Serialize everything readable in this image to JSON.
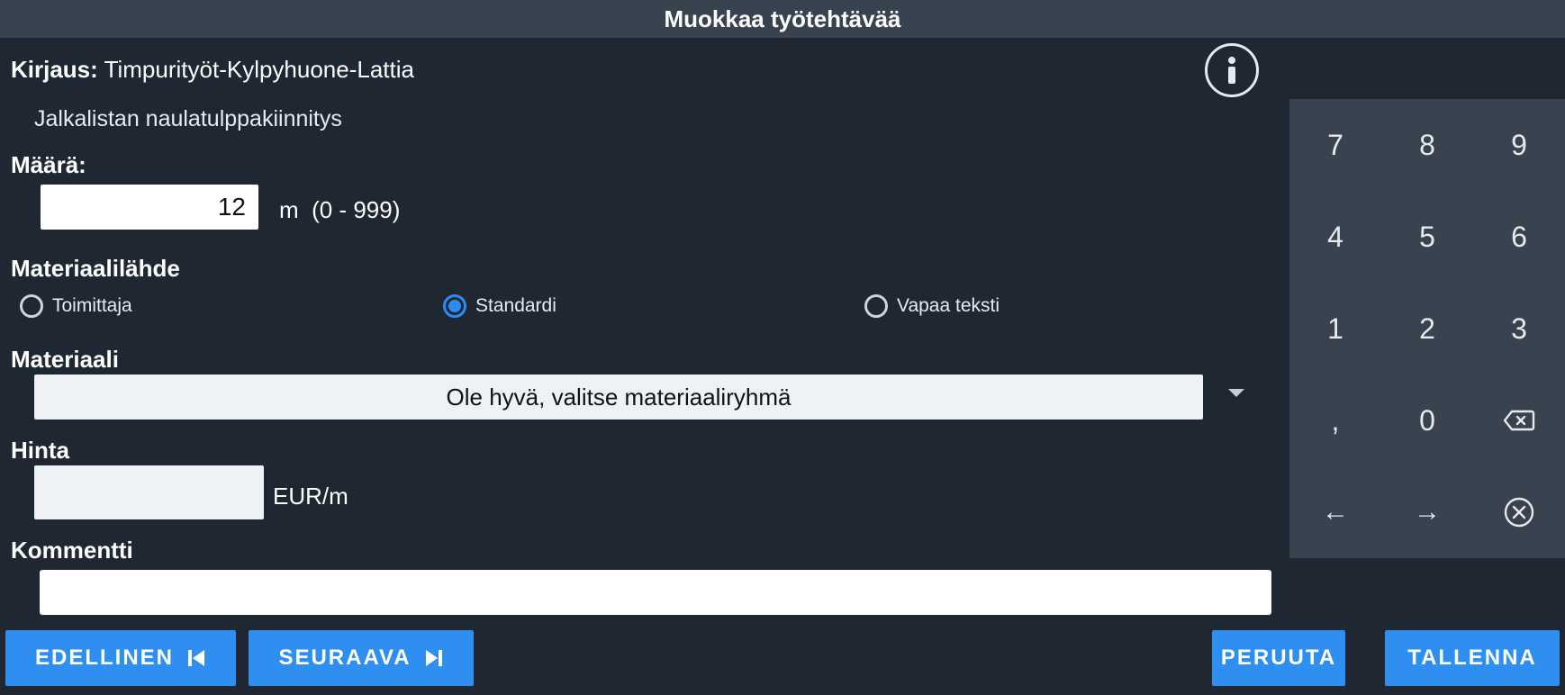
{
  "dialog": {
    "title": "Muokkaa työtehtävää"
  },
  "entry": {
    "label": "Kirjaus:",
    "value": "Timpurityöt-Kylpyhuone-Lattia",
    "description": "Jalkalistan naulatulppakiinnitys"
  },
  "quantity": {
    "label": "Määrä:",
    "value": "12",
    "unit_range": "m  (0 - 999)"
  },
  "material_source": {
    "label": "Materiaalilähde",
    "options": [
      {
        "label": "Toimittaja",
        "selected": false
      },
      {
        "label": "Standardi",
        "selected": true
      },
      {
        "label": "Vapaa teksti",
        "selected": false
      }
    ]
  },
  "material": {
    "label": "Materiaali",
    "placeholder": "Ole hyvä, valitse materiaaliryhmä"
  },
  "price": {
    "label": "Hinta",
    "value": "",
    "unit": "EUR/m"
  },
  "comment": {
    "label": "Kommentti",
    "value": ""
  },
  "numpad": {
    "keys": [
      "7",
      "8",
      "9",
      "4",
      "5",
      "6",
      "1",
      "2",
      "3",
      ",",
      "0",
      "backspace-icon",
      "←",
      "→",
      "clear-icon"
    ]
  },
  "buttons": {
    "previous": "EDELLINEN",
    "next": "SEURAAVA",
    "cancel": "PERUUTA",
    "save": "TALLENNA"
  },
  "colors": {
    "accent": "#2f8ff0",
    "background": "#1f2733",
    "titlebar": "#39424f",
    "radio_selected": "#2d8cf0"
  },
  "icons": [
    "info-icon",
    "dropdown-arrow-icon",
    "backspace-icon",
    "clear-icon",
    "skip-previous-icon",
    "skip-next-icon"
  ]
}
